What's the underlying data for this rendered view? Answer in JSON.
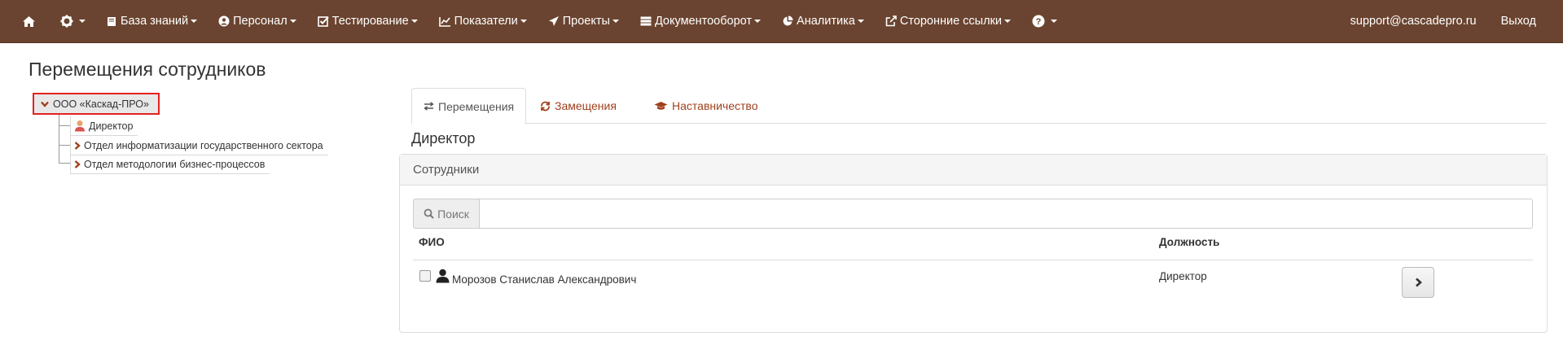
{
  "nav": {
    "items": [
      {
        "label": ""
      },
      {
        "label": ""
      },
      {
        "label": "База знаний"
      },
      {
        "label": "Персонал"
      },
      {
        "label": "Тестирование"
      },
      {
        "label": "Показатели"
      },
      {
        "label": "Проекты"
      },
      {
        "label": "Документооборот"
      },
      {
        "label": "Аналитика"
      },
      {
        "label": "Сторонние ссылки"
      },
      {
        "label": ""
      }
    ],
    "user_email": "support@cascadepro.ru",
    "logout": "Выход",
    "bg_color": "#6a4430"
  },
  "page": {
    "title": "Перемещения сотрудников"
  },
  "tree": {
    "root": "ООО «Каскад-ПРО»",
    "children": [
      {
        "label": "Директор",
        "icon": "person-icon"
      },
      {
        "label": "Отдел информатизации государственного сектора",
        "icon": "chevron-right-icon"
      },
      {
        "label": "Отдел методологии бизнес-процессов",
        "icon": "chevron-right-icon"
      }
    ]
  },
  "tabs": [
    {
      "label": "Перемещения",
      "active": true
    },
    {
      "label": "Замещения",
      "active": false
    },
    {
      "label": "Наставничество",
      "active": false
    }
  ],
  "section": {
    "title": "Директор"
  },
  "panel": {
    "heading": "Сотрудники",
    "search_label": "Поиск",
    "search_value": "",
    "columns": [
      "ФИО",
      "Должность"
    ],
    "rows": [
      {
        "name": "Морозов Станислав Александрович",
        "position": "Директор",
        "checked": false
      }
    ]
  },
  "colors": {
    "accent": "#a0401d",
    "highlight_border": "#e5211e"
  }
}
